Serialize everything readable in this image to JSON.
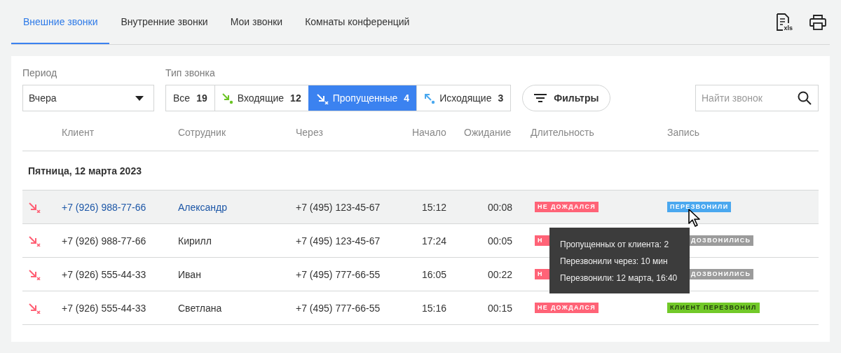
{
  "tabs": [
    {
      "label": "Внешние звонки",
      "selected": true
    },
    {
      "label": "Внутренние звонки",
      "selected": false
    },
    {
      "label": "Мои звонки",
      "selected": false
    },
    {
      "label": "Комнаты конференций",
      "selected": false
    }
  ],
  "export_icon_label": "xls",
  "period": {
    "label": "Период",
    "value": "Вчера"
  },
  "call_type": {
    "label": "Тип звонка",
    "options": [
      {
        "kind": "all",
        "label": "Все",
        "count": "19",
        "selected": false
      },
      {
        "kind": "incoming",
        "label": "Входящие",
        "count": "12",
        "selected": false
      },
      {
        "kind": "missed",
        "label": "Пропущенные",
        "count": "4",
        "selected": true
      },
      {
        "kind": "outgoing",
        "label": "Исходящие",
        "count": "3",
        "selected": false
      }
    ]
  },
  "filters_button": "Фильтры",
  "search": {
    "placeholder": "Найти звонок"
  },
  "table": {
    "columns": [
      "Клиент",
      "Сотрудник",
      "Через",
      "Начало",
      "Ожидание",
      "Длительность",
      "Запись"
    ],
    "groups": [
      {
        "date": "Пятница, 12 марта 2023",
        "rows": [
          {
            "kind": "missed",
            "client": "+7 (926) 988-77-66",
            "employee": "Александр",
            "via": "+7 (495) 123-45-67",
            "start": "15:12",
            "wait": "00:08",
            "duration_status": {
              "kind": "not_waited",
              "text": "НЕ ДОЖДАЛСЯ"
            },
            "record_status": {
              "kind": "called_back",
              "text": "ПЕРЕЗВОНИЛИ"
            },
            "selected": true
          },
          {
            "kind": "missed",
            "client": "+7 (926) 988-77-66",
            "employee": "Кирилл",
            "via": "+7 (495) 123-45-67",
            "start": "17:24",
            "wait": "00:05",
            "duration_status": {
              "kind": "not_waited",
              "text": "Н",
              "covered": true
            },
            "record_status": {
              "kind": "not_reached",
              "text": "ДОЗВОНИЛИСЬ",
              "covered": true
            },
            "selected": false
          },
          {
            "kind": "missed",
            "client": "+7 (926) 555-44-33",
            "employee": "Иван",
            "via": "+7 (495) 777-66-55",
            "start": "16:05",
            "wait": "00:22",
            "duration_status": {
              "kind": "not_waited",
              "text": "Н",
              "covered": true
            },
            "record_status": {
              "kind": "not_reached",
              "text": "ДОЗВОНИЛИСЬ",
              "covered": true
            },
            "selected": false
          },
          {
            "kind": "missed",
            "client": "+7 (926) 555-44-33",
            "employee": "Светлана",
            "via": "+7 (495) 777-66-55",
            "start": "15:16",
            "wait": "00:15",
            "duration_status": {
              "kind": "not_waited",
              "text": "НЕ ДОЖДАЛСЯ"
            },
            "record_status": {
              "kind": "client_called_back",
              "text": "КЛИЕНТ ПЕРЕЗВОНИЛ"
            },
            "selected": false
          }
        ]
      }
    ]
  },
  "tooltip": {
    "lines": [
      "Пропущенных от клиента: 2",
      "Перезвонили через: 10 мин",
      "Перезвонили: 12 марта, 16:40"
    ]
  }
}
